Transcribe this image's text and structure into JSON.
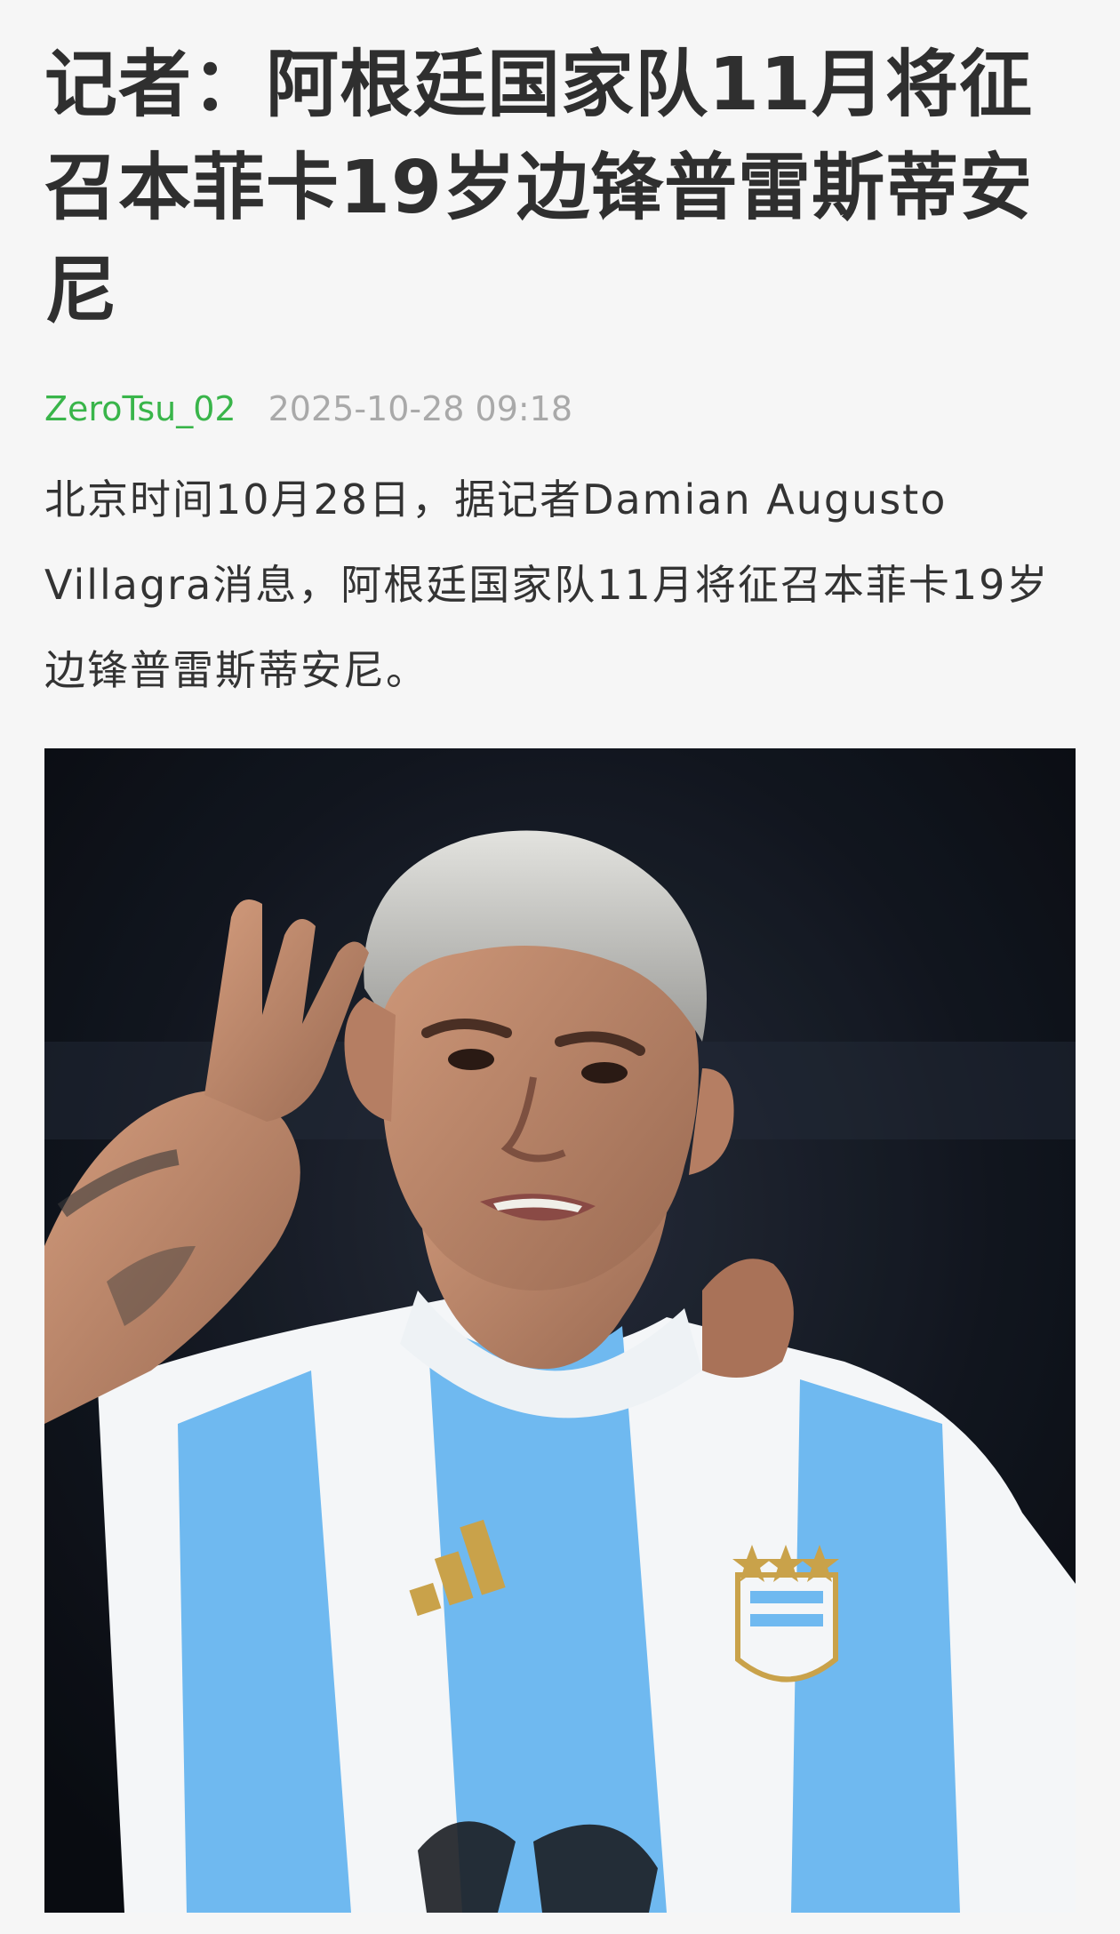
{
  "article": {
    "title": "记者：阿根廷国家队11月将征召本菲卡19岁边锋普雷斯蒂安尼",
    "author": "ZeroTsu_02",
    "datetime": "2025-10-28 09:18",
    "body": "北京时间10月28日，据记者Damian Augusto Villagra消息，阿根廷国家队11月将征召本菲卡19岁边锋普雷斯蒂安尼。"
  },
  "photo": {
    "jersey_brand_icon": "adidas-stripes-icon",
    "crest_icon": "afa-crest-icon",
    "colors": {
      "sky_blue": "#6fb9f0",
      "white": "#f4f6f8",
      "gold": "#c9a24a",
      "background": "#101319"
    }
  }
}
